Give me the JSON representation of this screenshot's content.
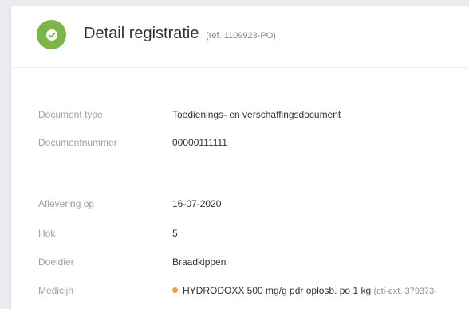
{
  "header": {
    "title": "Detail registratie",
    "ref": "(ref. 1109923-PO)",
    "status_icon": "check-icon",
    "status_color": "#7ab648"
  },
  "details": [
    {
      "label": "Document type",
      "value": "Toedienings- en verschaffingsdocument"
    },
    {
      "label": "Documentnummer",
      "value": "00000111111"
    },
    {
      "label": "Aflevering op",
      "value": "16-07-2020"
    },
    {
      "label": "Hok",
      "value": "5"
    },
    {
      "label": "Doeldier",
      "value": "Braadkippen"
    }
  ],
  "medicine": {
    "label": "Medicijn",
    "name": "HYDRODOXX 500 mg/g pdr oplosb. po 1 kg",
    "extra": "(cti-ext. 379373-",
    "dot_color": "#f0a050"
  }
}
